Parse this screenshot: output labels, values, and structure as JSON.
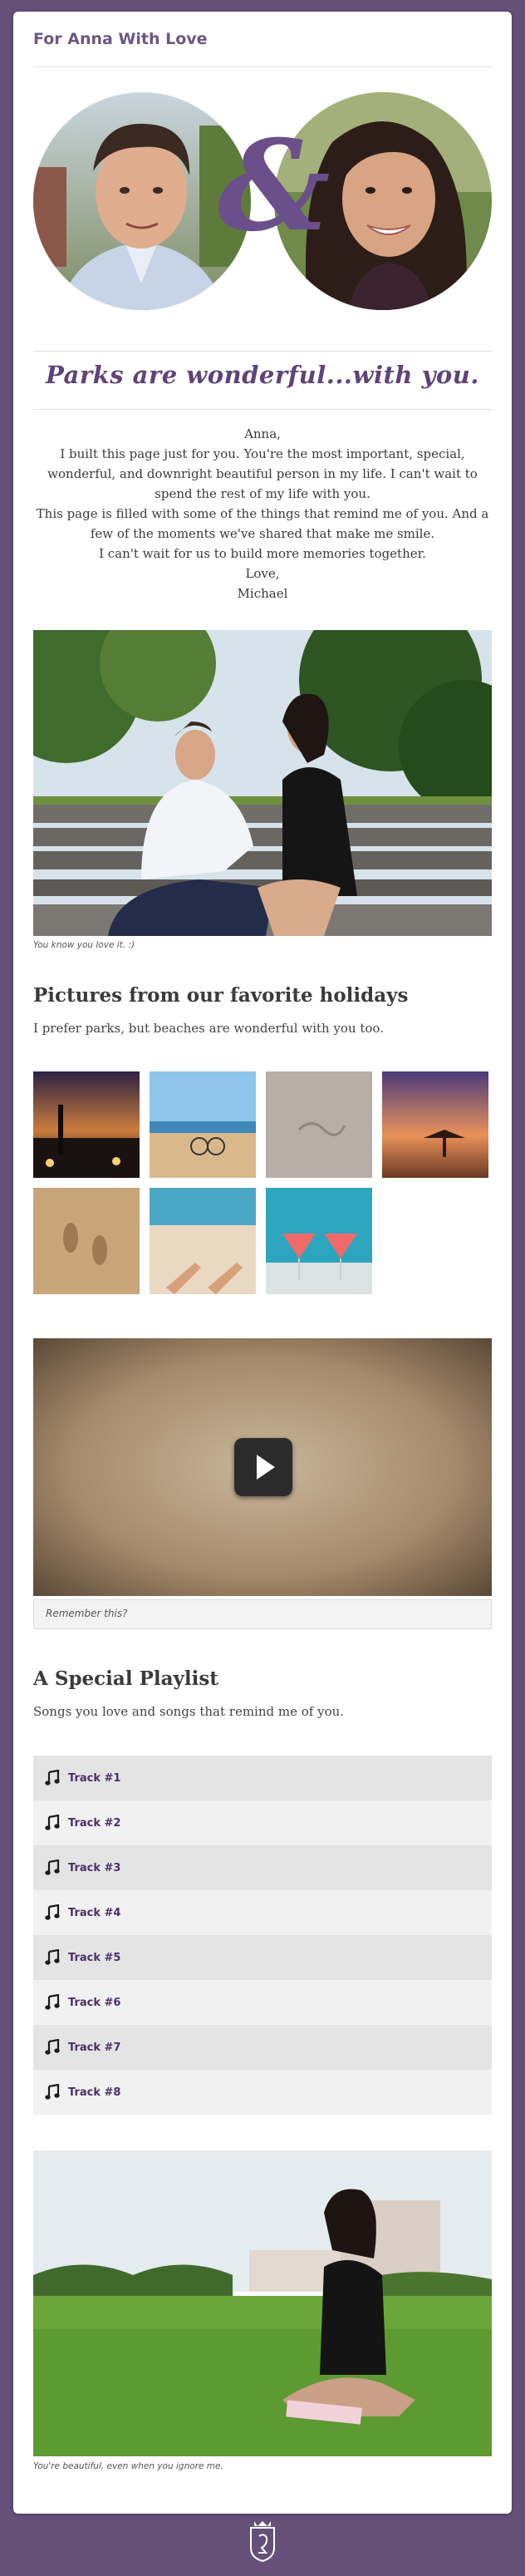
{
  "site": {
    "title": "For Anna With Love"
  },
  "couple": {
    "ampersand": "&"
  },
  "tagline": "Parks are wonderful...with you.",
  "letter": {
    "lines": [
      "Anna,",
      "I built this page just for you. You're the most important, special, wonderful, and downright beautiful person in my life. I can't wait to spend the rest of my life with you.",
      "This page is filled with some of the things that remind me of you. And a few of the moments we've shared that make me smile.",
      "I can't wait for us to build more memories together.",
      "Love,",
      "Michael"
    ]
  },
  "photo1": {
    "caption": "You know you love it. :)"
  },
  "holidays": {
    "heading": "Pictures from our favorite holidays",
    "subtext": "I prefer parks, but beaches are wonderful with you too."
  },
  "video": {
    "caption": "Remember this?"
  },
  "playlist": {
    "heading": "A Special Playlist",
    "subtext": "Songs you love and songs that remind me of you.",
    "tracks": [
      "Track #1",
      "Track #2",
      "Track #3",
      "Track #4",
      "Track #5",
      "Track #6",
      "Track #7",
      "Track #8"
    ]
  },
  "photo2": {
    "caption": "You're beautiful, even when you ignore me."
  },
  "colors": {
    "background": "#66507a",
    "accent": "#5e4478",
    "track_text": "#4a2f66"
  }
}
